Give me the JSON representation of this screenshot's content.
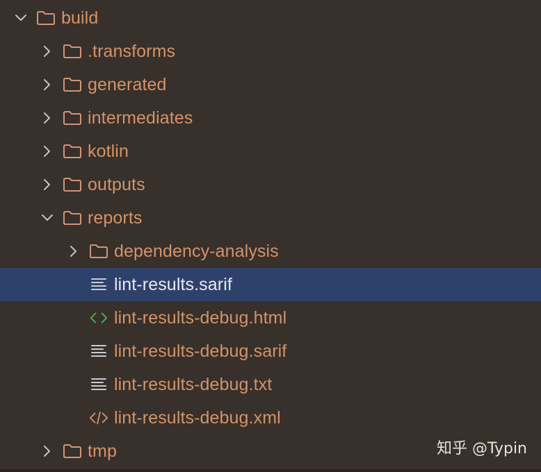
{
  "colors": {
    "background": "#38302a",
    "selection": "#2e416b",
    "label_text": "#d4936a",
    "selected_text": "#e8eaf2",
    "folder_icon": "#d1957a",
    "html_icon": "#4fae63",
    "xml_icon": "#d4936a",
    "text_icon": "#c9ccd4",
    "chevron": "#c8c2bd"
  },
  "tree": {
    "items": [
      {
        "label": "build",
        "type": "folder",
        "state": "expanded",
        "depth": 0
      },
      {
        "label": ".transforms",
        "type": "folder",
        "state": "collapsed",
        "depth": 1
      },
      {
        "label": "generated",
        "type": "folder",
        "state": "collapsed",
        "depth": 1
      },
      {
        "label": "intermediates",
        "type": "folder",
        "state": "collapsed",
        "depth": 1
      },
      {
        "label": "kotlin",
        "type": "folder",
        "state": "collapsed",
        "depth": 1
      },
      {
        "label": "outputs",
        "type": "folder",
        "state": "collapsed",
        "depth": 1
      },
      {
        "label": "reports",
        "type": "folder",
        "state": "expanded",
        "depth": 1
      },
      {
        "label": "dependency-analysis",
        "type": "folder",
        "state": "collapsed",
        "depth": 2
      },
      {
        "label": "lint-results.sarif",
        "type": "text-file",
        "state": "selected",
        "depth": 2
      },
      {
        "label": "lint-results-debug.html",
        "type": "html-file",
        "state": "none",
        "depth": 2
      },
      {
        "label": "lint-results-debug.sarif",
        "type": "text-file",
        "state": "none",
        "depth": 2
      },
      {
        "label": "lint-results-debug.txt",
        "type": "text-file",
        "state": "none",
        "depth": 2
      },
      {
        "label": "lint-results-debug.xml",
        "type": "xml-file",
        "state": "none",
        "depth": 2
      },
      {
        "label": "tmp",
        "type": "folder",
        "state": "collapsed",
        "depth": 1
      }
    ]
  },
  "watermark": "知乎 @Typin"
}
